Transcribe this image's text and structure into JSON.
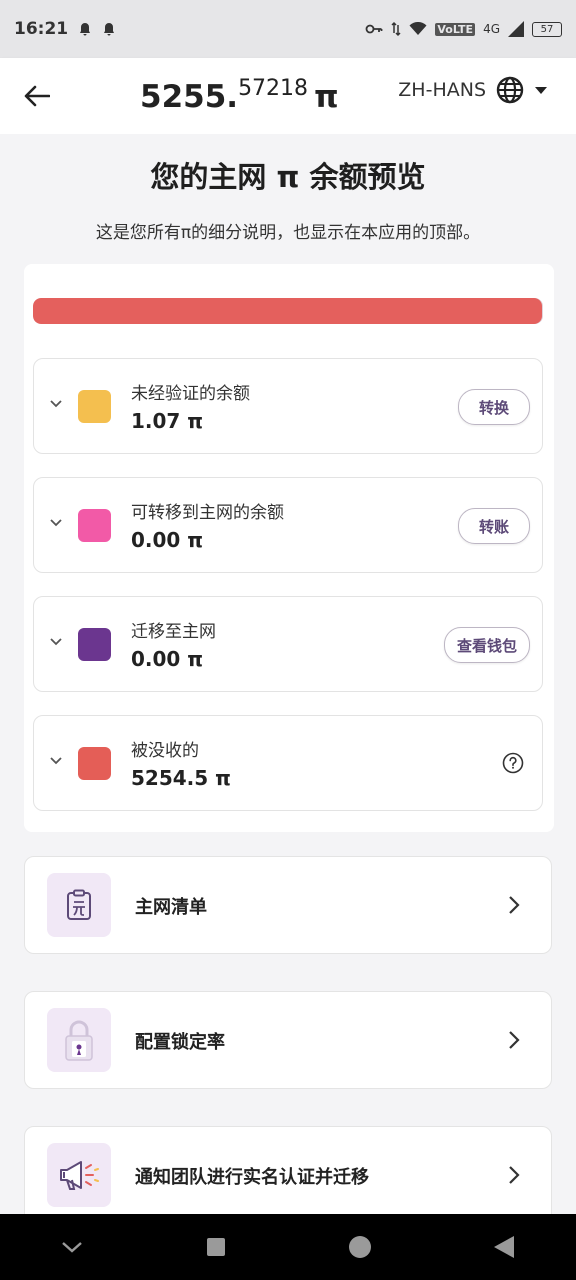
{
  "status_bar": {
    "time": "16:21",
    "network": "4G",
    "volte": "VoLTE",
    "battery": "57",
    "icons": [
      "bell-icon",
      "bell-icon",
      "key-icon",
      "data-arrows-icon",
      "wifi-icon",
      "signal-icon",
      "battery-icon"
    ]
  },
  "header": {
    "balance_main": "5255.",
    "balance_decimals": "57218",
    "pi_symbol": "π",
    "language": "ZH-HANS",
    "back_icon": "arrow-left-icon",
    "globe_icon": "globe-icon",
    "dropdown_icon": "caret-down-icon"
  },
  "page": {
    "title": "您的主网 π 余额预览",
    "subtitle": "这是您所有π的细分说明，也显示在本应用的顶部。"
  },
  "progress": {
    "forfeited_fraction": 0.998,
    "fill_color": "#e4605d",
    "track_color": "#e1d3da"
  },
  "balances": [
    {
      "label": "未经验证的余额",
      "amount": "1.07 π",
      "color": "#f4bf4f",
      "action": "转换"
    },
    {
      "label": "可转移到主网的余额",
      "amount": "0.00 π",
      "color": "#f25aa7",
      "action": "转账"
    },
    {
      "label": "迁移至主网",
      "amount": "0.00 π",
      "color": "#6b368f",
      "action": "查看钱包"
    },
    {
      "label": "被没收的",
      "amount": "5254.5 π",
      "color": "#e45e57",
      "action": ""
    }
  ],
  "menu": [
    {
      "label": "主网清单",
      "icon": "clipboard-yuan-icon"
    },
    {
      "label": "配置锁定率",
      "icon": "padlock-icon"
    },
    {
      "label": "通知团队进行实名认证并迁移",
      "icon": "megaphone-icon"
    }
  ],
  "nav": {
    "icons": [
      "collapse-chevron-icon",
      "recents-square-icon",
      "home-circle-icon",
      "back-triangle-icon"
    ]
  },
  "colors": {
    "accent": "#5d4a78",
    "card_border": "#e3e3e3"
  }
}
